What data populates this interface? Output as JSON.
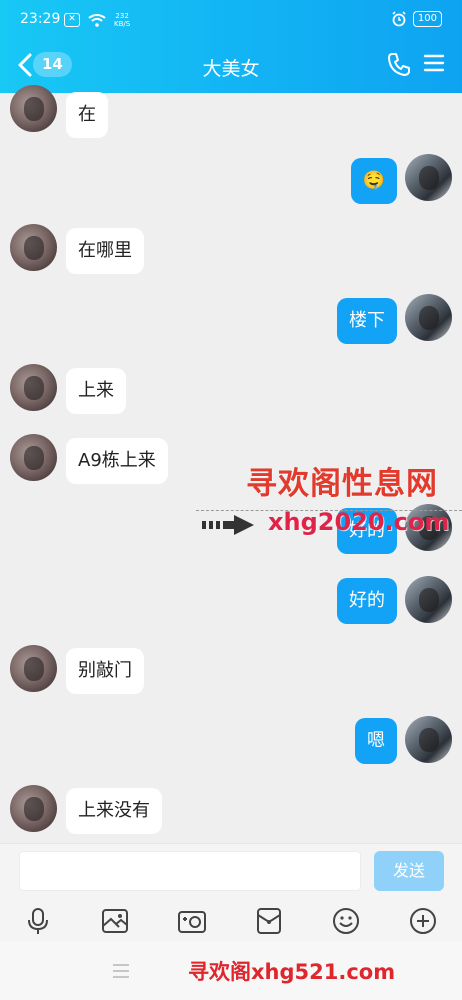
{
  "status_bar": {
    "time": "23:29",
    "badge": "✕",
    "speed_top": "232",
    "speed_bottom": "KB/S",
    "battery": "100"
  },
  "header": {
    "unread_count": "14",
    "title": "大美女"
  },
  "messages": [
    {
      "side": "left",
      "text": "在"
    },
    {
      "side": "right",
      "text": "🤤"
    },
    {
      "side": "left",
      "text": "在哪里"
    },
    {
      "side": "right",
      "text": "楼下"
    },
    {
      "side": "left",
      "text": "上来"
    },
    {
      "side": "left",
      "text": "A9栋上来"
    },
    {
      "side": "right",
      "text": "好的"
    },
    {
      "side": "right",
      "text": "好的"
    },
    {
      "side": "left",
      "text": "别敲门"
    },
    {
      "side": "right",
      "text": "嗯"
    },
    {
      "side": "left",
      "text": "上来没有"
    }
  ],
  "watermark": {
    "title": "寻欢阁性息网",
    "url": "xhg2020.com"
  },
  "composer": {
    "send_label": "发送"
  },
  "toolbar_icons": [
    "microphone-icon",
    "image-icon",
    "camera-icon",
    "red-packet-icon",
    "emoji-icon",
    "plus-icon"
  ],
  "footer_watermark": "寻欢阁xhg521.com",
  "colors": {
    "header": "#12b3f4",
    "sent_bubble": "#12a3f6",
    "send_button": "#8fd1f8",
    "watermark": "#e23a2c"
  }
}
